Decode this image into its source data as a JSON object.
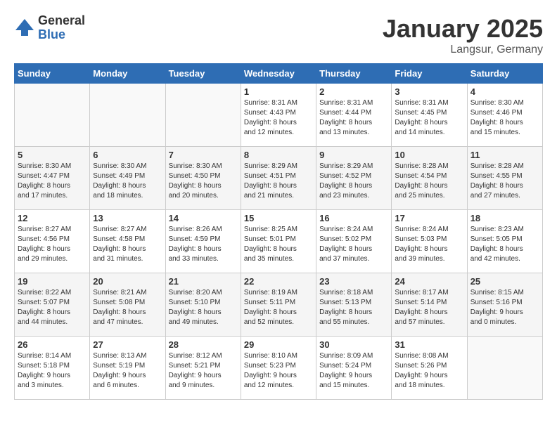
{
  "logo": {
    "general": "General",
    "blue": "Blue"
  },
  "title": "January 2025",
  "subtitle": "Langsur, Germany",
  "weekdays": [
    "Sunday",
    "Monday",
    "Tuesday",
    "Wednesday",
    "Thursday",
    "Friday",
    "Saturday"
  ],
  "weeks": [
    [
      {
        "day": "",
        "info": ""
      },
      {
        "day": "",
        "info": ""
      },
      {
        "day": "",
        "info": ""
      },
      {
        "day": "1",
        "info": "Sunrise: 8:31 AM\nSunset: 4:43 PM\nDaylight: 8 hours\nand 12 minutes."
      },
      {
        "day": "2",
        "info": "Sunrise: 8:31 AM\nSunset: 4:44 PM\nDaylight: 8 hours\nand 13 minutes."
      },
      {
        "day": "3",
        "info": "Sunrise: 8:31 AM\nSunset: 4:45 PM\nDaylight: 8 hours\nand 14 minutes."
      },
      {
        "day": "4",
        "info": "Sunrise: 8:30 AM\nSunset: 4:46 PM\nDaylight: 8 hours\nand 15 minutes."
      }
    ],
    [
      {
        "day": "5",
        "info": "Sunrise: 8:30 AM\nSunset: 4:47 PM\nDaylight: 8 hours\nand 17 minutes."
      },
      {
        "day": "6",
        "info": "Sunrise: 8:30 AM\nSunset: 4:49 PM\nDaylight: 8 hours\nand 18 minutes."
      },
      {
        "day": "7",
        "info": "Sunrise: 8:30 AM\nSunset: 4:50 PM\nDaylight: 8 hours\nand 20 minutes."
      },
      {
        "day": "8",
        "info": "Sunrise: 8:29 AM\nSunset: 4:51 PM\nDaylight: 8 hours\nand 21 minutes."
      },
      {
        "day": "9",
        "info": "Sunrise: 8:29 AM\nSunset: 4:52 PM\nDaylight: 8 hours\nand 23 minutes."
      },
      {
        "day": "10",
        "info": "Sunrise: 8:28 AM\nSunset: 4:54 PM\nDaylight: 8 hours\nand 25 minutes."
      },
      {
        "day": "11",
        "info": "Sunrise: 8:28 AM\nSunset: 4:55 PM\nDaylight: 8 hours\nand 27 minutes."
      }
    ],
    [
      {
        "day": "12",
        "info": "Sunrise: 8:27 AM\nSunset: 4:56 PM\nDaylight: 8 hours\nand 29 minutes."
      },
      {
        "day": "13",
        "info": "Sunrise: 8:27 AM\nSunset: 4:58 PM\nDaylight: 8 hours\nand 31 minutes."
      },
      {
        "day": "14",
        "info": "Sunrise: 8:26 AM\nSunset: 4:59 PM\nDaylight: 8 hours\nand 33 minutes."
      },
      {
        "day": "15",
        "info": "Sunrise: 8:25 AM\nSunset: 5:01 PM\nDaylight: 8 hours\nand 35 minutes."
      },
      {
        "day": "16",
        "info": "Sunrise: 8:24 AM\nSunset: 5:02 PM\nDaylight: 8 hours\nand 37 minutes."
      },
      {
        "day": "17",
        "info": "Sunrise: 8:24 AM\nSunset: 5:03 PM\nDaylight: 8 hours\nand 39 minutes."
      },
      {
        "day": "18",
        "info": "Sunrise: 8:23 AM\nSunset: 5:05 PM\nDaylight: 8 hours\nand 42 minutes."
      }
    ],
    [
      {
        "day": "19",
        "info": "Sunrise: 8:22 AM\nSunset: 5:07 PM\nDaylight: 8 hours\nand 44 minutes."
      },
      {
        "day": "20",
        "info": "Sunrise: 8:21 AM\nSunset: 5:08 PM\nDaylight: 8 hours\nand 47 minutes."
      },
      {
        "day": "21",
        "info": "Sunrise: 8:20 AM\nSunset: 5:10 PM\nDaylight: 8 hours\nand 49 minutes."
      },
      {
        "day": "22",
        "info": "Sunrise: 8:19 AM\nSunset: 5:11 PM\nDaylight: 8 hours\nand 52 minutes."
      },
      {
        "day": "23",
        "info": "Sunrise: 8:18 AM\nSunset: 5:13 PM\nDaylight: 8 hours\nand 55 minutes."
      },
      {
        "day": "24",
        "info": "Sunrise: 8:17 AM\nSunset: 5:14 PM\nDaylight: 8 hours\nand 57 minutes."
      },
      {
        "day": "25",
        "info": "Sunrise: 8:15 AM\nSunset: 5:16 PM\nDaylight: 9 hours\nand 0 minutes."
      }
    ],
    [
      {
        "day": "26",
        "info": "Sunrise: 8:14 AM\nSunset: 5:18 PM\nDaylight: 9 hours\nand 3 minutes."
      },
      {
        "day": "27",
        "info": "Sunrise: 8:13 AM\nSunset: 5:19 PM\nDaylight: 9 hours\nand 6 minutes."
      },
      {
        "day": "28",
        "info": "Sunrise: 8:12 AM\nSunset: 5:21 PM\nDaylight: 9 hours\nand 9 minutes."
      },
      {
        "day": "29",
        "info": "Sunrise: 8:10 AM\nSunset: 5:23 PM\nDaylight: 9 hours\nand 12 minutes."
      },
      {
        "day": "30",
        "info": "Sunrise: 8:09 AM\nSunset: 5:24 PM\nDaylight: 9 hours\nand 15 minutes."
      },
      {
        "day": "31",
        "info": "Sunrise: 8:08 AM\nSunset: 5:26 PM\nDaylight: 9 hours\nand 18 minutes."
      },
      {
        "day": "",
        "info": ""
      }
    ]
  ]
}
